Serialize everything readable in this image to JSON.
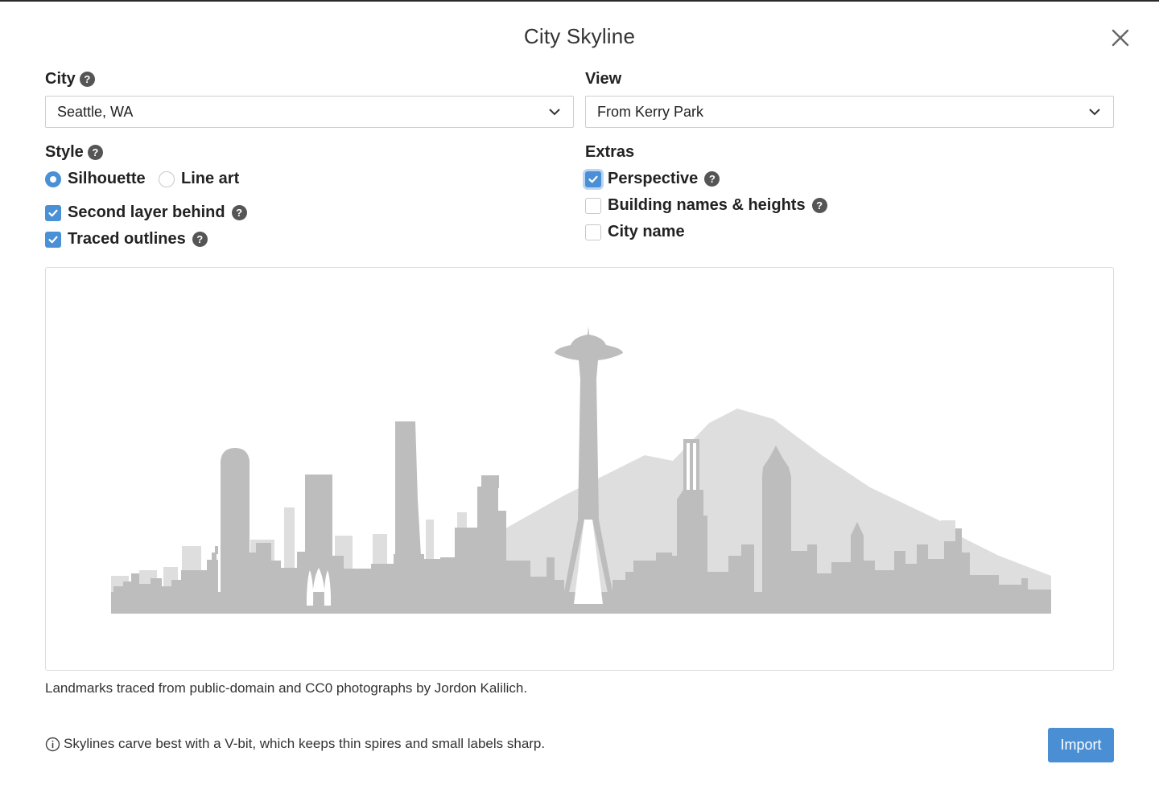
{
  "dialog": {
    "title": "City Skyline"
  },
  "city": {
    "label": "City",
    "value": "Seattle, WA"
  },
  "view": {
    "label": "View",
    "value": "From Kerry Park"
  },
  "style": {
    "label": "Style",
    "options": [
      {
        "label": "Silhouette",
        "selected": true
      },
      {
        "label": "Line art",
        "selected": false
      }
    ],
    "checks": [
      {
        "label": "Second layer behind",
        "checked": true
      },
      {
        "label": "Traced outlines",
        "checked": true
      }
    ]
  },
  "extras": {
    "label": "Extras",
    "checks": [
      {
        "label": "Perspective",
        "checked": true
      },
      {
        "label": "Building names & heights",
        "checked": false
      },
      {
        "label": "City name",
        "checked": false
      }
    ]
  },
  "preview": {
    "front_color": "#bdbdbd",
    "back_color": "#dedede"
  },
  "credit": "Landmarks traced from public-domain and CC0 photographs by Jordon Kalilich.",
  "tip": "Skylines carve best with a V-bit, which keeps thin spires and small labels sharp.",
  "import_label": "Import",
  "icons": {
    "close": "close-icon",
    "help": "help-icon",
    "chevron": "chevron-down-icon",
    "info": "info-icon"
  },
  "colors": {
    "accent": "#4a90d6"
  }
}
